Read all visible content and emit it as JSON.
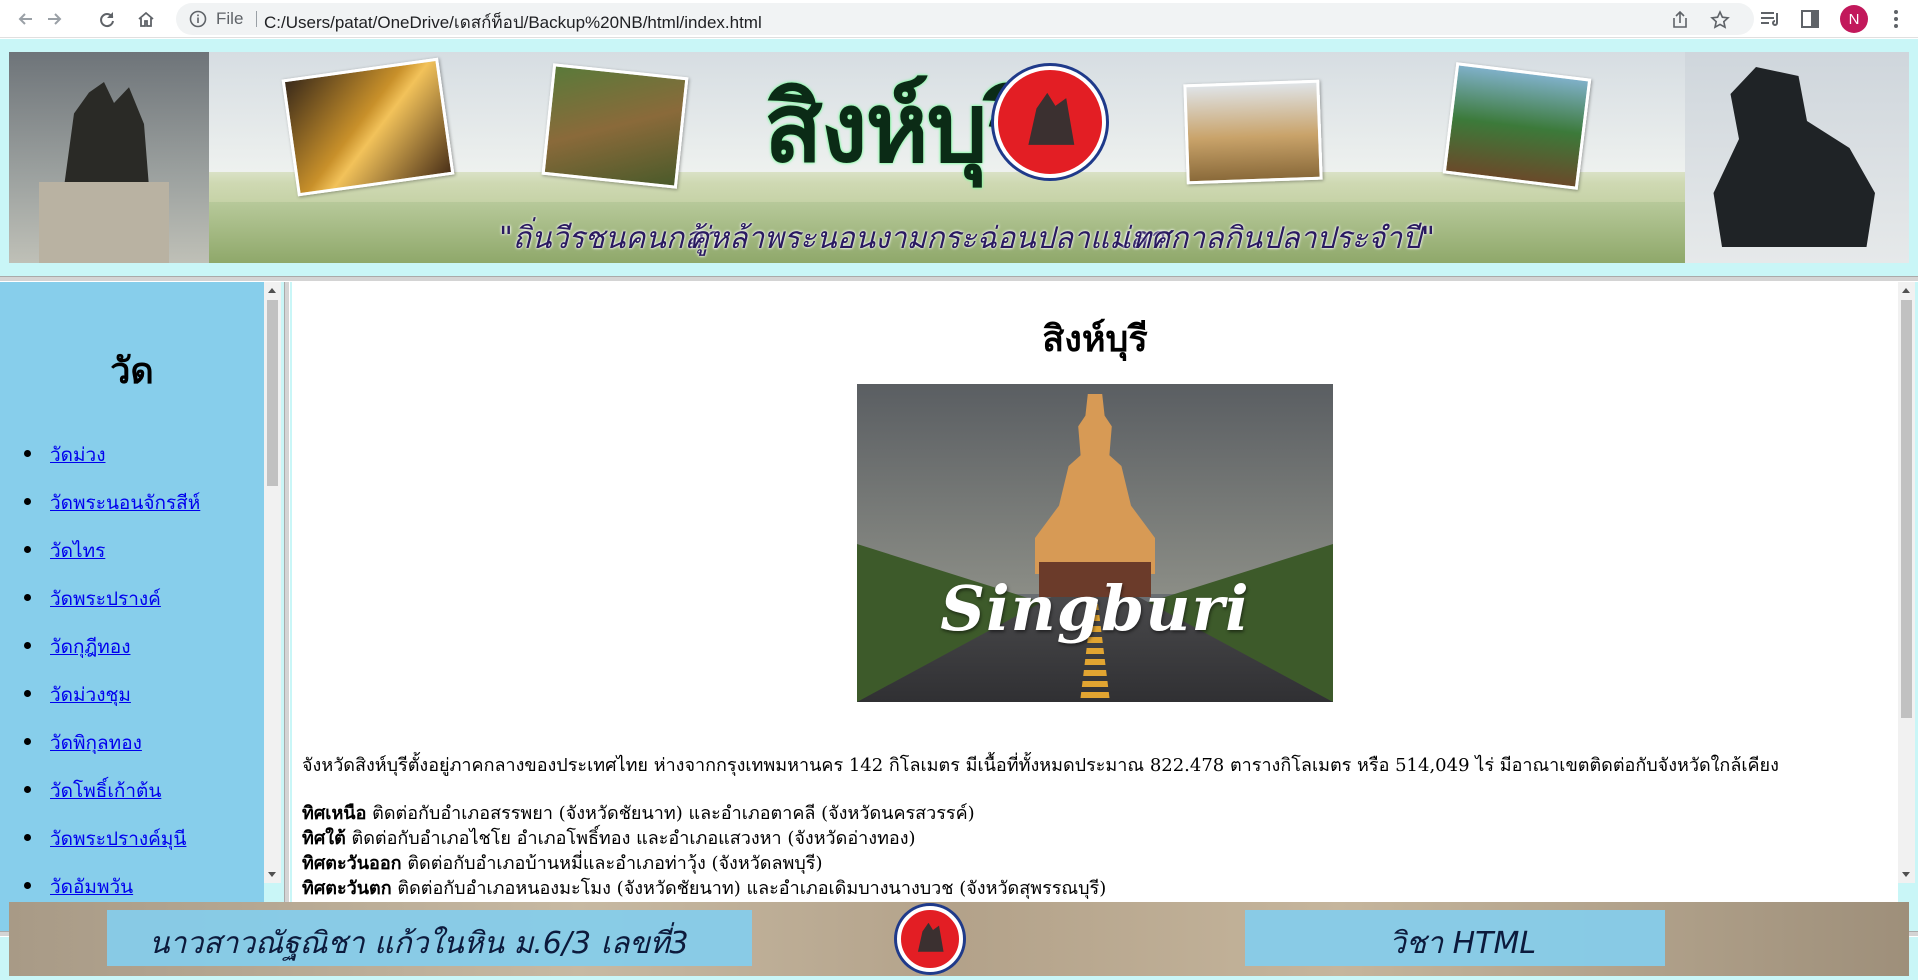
{
  "browser": {
    "file_label": "File",
    "url": "C:/Users/patat/OneDrive/เดสก์ท็อป/Backup%20NB/html/index.html",
    "profile_initial": "N",
    "profile_color": "#c2185b"
  },
  "banner": {
    "title": "สิงห์บุรี",
    "slogans": [
      "\"ถิ่นวีรชนคนกล้า",
      "คู่หล้าพระนอน",
      "งามกระฉ่อนปลาแม่ลา",
      "เทศกาลกินปลาประจำปี\""
    ]
  },
  "sidebar": {
    "title": "วัด",
    "background": "#87ceeb",
    "items": [
      "วัดม่วง",
      "วัดพระนอนจักรสีห์",
      "วัดไทร",
      "วัดพระปรางค์",
      "วัดกุฎีทอง",
      "วัดม่วงชุม",
      "วัดพิกุลทอง",
      "วัดโพธิ์เก้าต้น",
      "วัดพระปรางค์มุนี",
      "วัดอัมพวัน"
    ]
  },
  "main": {
    "title": "สิงห์บุรี",
    "hero_caption": "Singburi",
    "paragraph": "จังหวัดสิงห์บุรีตั้งอยู่ภาคกลางของประเทศไทย ห่างจากกรุงเทพมหานคร 142 กิโลเมตร มีเนื้อที่ทั้งหมดประมาณ 822.478 ตารางกิโลเมตร หรือ 514,049 ไร่ มีอาณาเขตติดต่อกับจังหวัดใกล้เคียง",
    "directions": [
      {
        "label": "ทิศเหนือ",
        "text": " ติดต่อกับอำเภอสรรพยา (จังหวัดชัยนาท) และอำเภอตาคลี (จังหวัดนครสวรรค์)"
      },
      {
        "label": "ทิศใต้",
        "text": " ติดต่อกับอำเภอไชโย อำเภอโพธิ์ทอง และอำเภอแสวงหา (จังหวัดอ่างทอง)"
      },
      {
        "label": "ทิศตะวันออก",
        "text": " ติดต่อกับอำเภอบ้านหมี่และอำเภอท่าวุ้ง (จังหวัดลพบุรี)"
      },
      {
        "label": "ทิศตะวันตก",
        "text": " ติดต่อกับอำเภอหนองมะโมง (จังหวัดชัยนาท) และอำเภอเดิมบางนางบวช (จังหวัดสุพรรณบุรี)"
      }
    ]
  },
  "footer": {
    "author": "นาวสาวณัฐณิชา  แก้วในหิน    ม.6/3  เลขที่3",
    "subject": "วิชา HTML"
  },
  "colors": {
    "page_background": "#c9f6f7",
    "link": "#0000ee"
  }
}
